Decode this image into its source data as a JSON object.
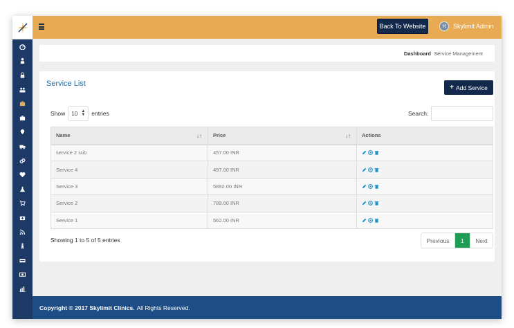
{
  "header": {
    "back_label": "Back To Website",
    "admin_name": "Skylimit Admin",
    "avatar_letter": "H"
  },
  "breadcrumb": {
    "home": "Dashboard",
    "separator": ">",
    "current": "Service Management"
  },
  "panel": {
    "title": "Service List",
    "add_label": "Add Service",
    "show_label": "Show",
    "page_length": "10",
    "entries_label": "entries",
    "search_label": "Search:",
    "search_value": ""
  },
  "table": {
    "columns": [
      "Name",
      "Price",
      "Actions"
    ],
    "rows": [
      {
        "name": "service 2 sub",
        "price": "457.00 INR"
      },
      {
        "name": "Service 4",
        "price": "497.00 INR"
      },
      {
        "name": "Service 3",
        "price": "5892.00 INR"
      },
      {
        "name": "Service 2",
        "price": "789.00 INR"
      },
      {
        "name": "Service 1",
        "price": "562.00 INR"
      }
    ]
  },
  "pagination": {
    "info": "Showing 1 to 5 of 5 entries",
    "prev": "Previous",
    "current": "1",
    "next": "Next"
  },
  "footer": {
    "copyright": "Copyright © 2017 Skylimit Clinics.",
    "rights": "All Rights Reserved."
  },
  "sidebar": {
    "icons": [
      "dashboard-icon",
      "user-icon",
      "lock-icon",
      "users-icon",
      "briefcase-icon",
      "suitcase-icon",
      "map-marker-icon",
      "ambulance-icon",
      "chain-icon",
      "heartbeat-icon",
      "flask-icon",
      "cart-icon",
      "medkit-icon",
      "rss-icon",
      "child-icon",
      "visa-icon",
      "money-icon",
      "bar-chart-icon"
    ]
  },
  "colors": {
    "topbar": "#e8ab54",
    "sidebar": "#1d3a66",
    "accent_button": "#13294b",
    "title": "#1f6fa7",
    "pager_active": "#1f9d55",
    "footer": "#1d4d84",
    "action_icon": "#1a8fc9"
  }
}
